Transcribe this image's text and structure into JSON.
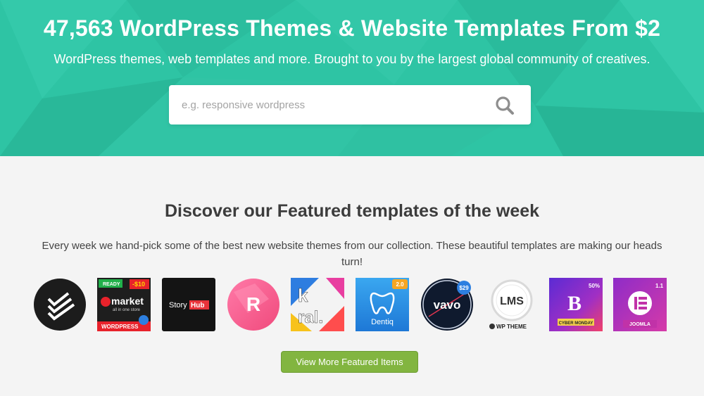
{
  "hero": {
    "title": "47,563 WordPress Themes & Website Templates From $2",
    "subtitle": "WordPress themes, web templates and more. Brought to you by the largest global community of creatives.",
    "background_color": "#2ec4a4"
  },
  "search": {
    "placeholder": "e.g. responsive wordpress",
    "value": "",
    "icon": "search-icon"
  },
  "featured": {
    "title": "Discover our Featured templates of the week",
    "description": "Every week we hand-pick some of the best new website themes from our collection. These beautiful templates are making our heads turn!",
    "button_label": "View More Featured Items",
    "button_color": "#82b540",
    "thumbnails": [
      {
        "name": "checklist-logo"
      },
      {
        "name": "emarket-theme",
        "badge_ready": "READY",
        "badge_price": "$10",
        "title": "market",
        "tagline": "all in one store",
        "footer": "WORDPRESS"
      },
      {
        "name": "storyhub-theme",
        "text_a": "Story",
        "text_b": "Hub"
      },
      {
        "name": "r-theme",
        "letter": "R"
      },
      {
        "name": "koral-theme",
        "line1": "k",
        "line2": "ral."
      },
      {
        "name": "dentiq-theme",
        "version": "2.0",
        "title": "Dentiq"
      },
      {
        "name": "vavo-theme",
        "price": "$29",
        "title": "vavo"
      },
      {
        "name": "lms-theme",
        "title": "LMS",
        "footer": "WP THEME"
      },
      {
        "name": "b-theme",
        "letter": "B",
        "discount": "50%",
        "footer": "CYBER MONDAY"
      },
      {
        "name": "elementor-joomla-theme",
        "version": "1.1",
        "footer": "JOOMLA"
      }
    ]
  }
}
